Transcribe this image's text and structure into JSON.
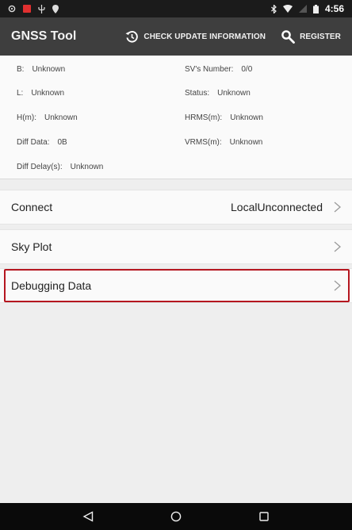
{
  "status_bar": {
    "time": "4:56",
    "left_icons": [
      "settings-icon",
      "notification-icon",
      "usb-icon",
      "location-icon"
    ],
    "right_icons": [
      "bluetooth-icon",
      "wifi-icon",
      "signal-icon",
      "battery-icon"
    ]
  },
  "app_bar": {
    "title": "GNSS Tool",
    "actions": {
      "check_update": "CHECK UPDATE INFORMATION",
      "register": "REGISTER"
    }
  },
  "info": {
    "b": {
      "label": "B:",
      "value": "Unknown"
    },
    "l": {
      "label": "L:",
      "value": "Unknown"
    },
    "h": {
      "label": "H(m):",
      "value": "Unknown"
    },
    "diff_data": {
      "label": "Diff Data:",
      "value": "0B"
    },
    "diff_delay": {
      "label": "Diff Delay(s):",
      "value": "Unknown"
    },
    "sv_number": {
      "label": "SV's Number:",
      "value": "0/0"
    },
    "status": {
      "label": "Status:",
      "value": "Unknown"
    },
    "hrms": {
      "label": "HRMS(m):",
      "value": "Unknown"
    },
    "vrms": {
      "label": "VRMS(m):",
      "value": "Unknown"
    }
  },
  "menu": {
    "connect": {
      "label": "Connect",
      "value": "LocalUnconnected"
    },
    "sky_plot": {
      "label": "Sky Plot"
    },
    "debugging_data": {
      "label": "Debugging Data"
    }
  },
  "colors": {
    "status_bar_bg": "#1b1b1b",
    "app_bar_bg": "#3e3e3e",
    "highlight_border": "#b5161f",
    "nav_bar_bg": "#0a0a0a"
  },
  "nav": [
    "back-icon",
    "home-icon",
    "recents-icon"
  ]
}
